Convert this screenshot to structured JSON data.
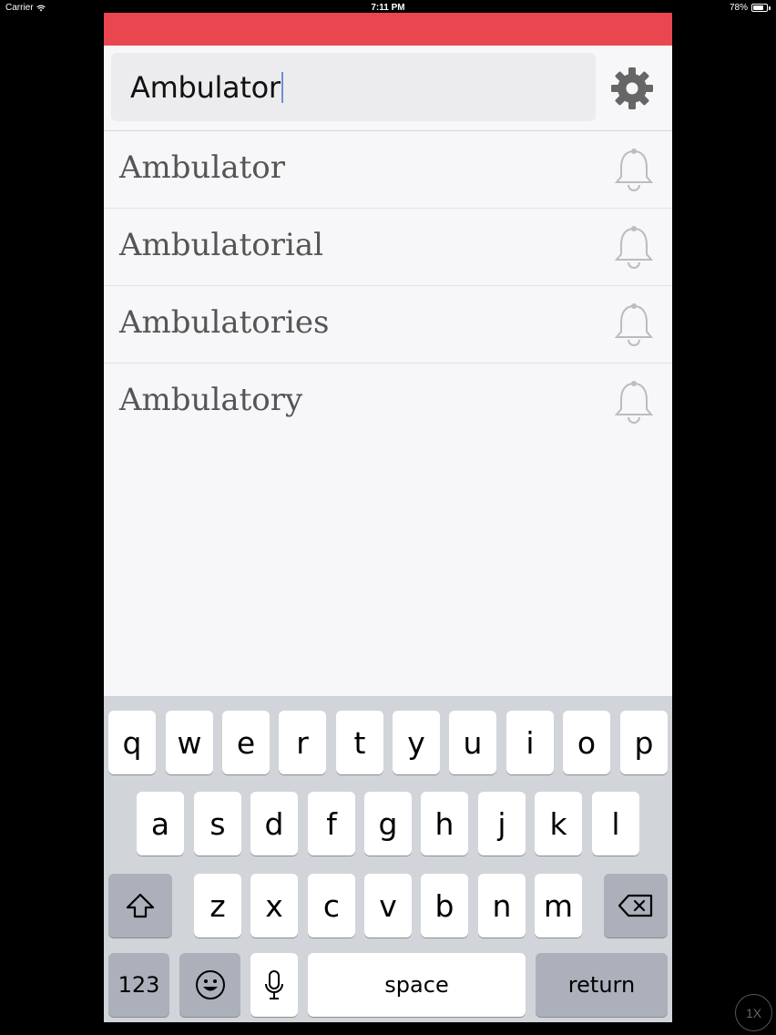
{
  "status_bar": {
    "carrier": "Carrier",
    "time": "7:11 PM",
    "battery_percent": "78%",
    "battery_level": 0.78
  },
  "app": {
    "accent_color": "#e9464f",
    "search": {
      "value": "Ambulator",
      "settings_icon": "gear-icon"
    },
    "results": [
      {
        "label": "Ambulator",
        "icon": "bell-icon"
      },
      {
        "label": "Ambulatorial",
        "icon": "bell-icon"
      },
      {
        "label": "Ambulatories",
        "icon": "bell-icon"
      },
      {
        "label": "Ambulatory",
        "icon": "bell-icon"
      }
    ]
  },
  "keyboard": {
    "row1": [
      "q",
      "w",
      "e",
      "r",
      "t",
      "y",
      "u",
      "i",
      "o",
      "p"
    ],
    "row2": [
      "a",
      "s",
      "d",
      "f",
      "g",
      "h",
      "j",
      "k",
      "l"
    ],
    "row3": [
      "z",
      "x",
      "c",
      "v",
      "b",
      "n",
      "m"
    ],
    "numbers_label": "123",
    "space_label": "space",
    "return_label": "return"
  },
  "zoom_badge": "1X"
}
